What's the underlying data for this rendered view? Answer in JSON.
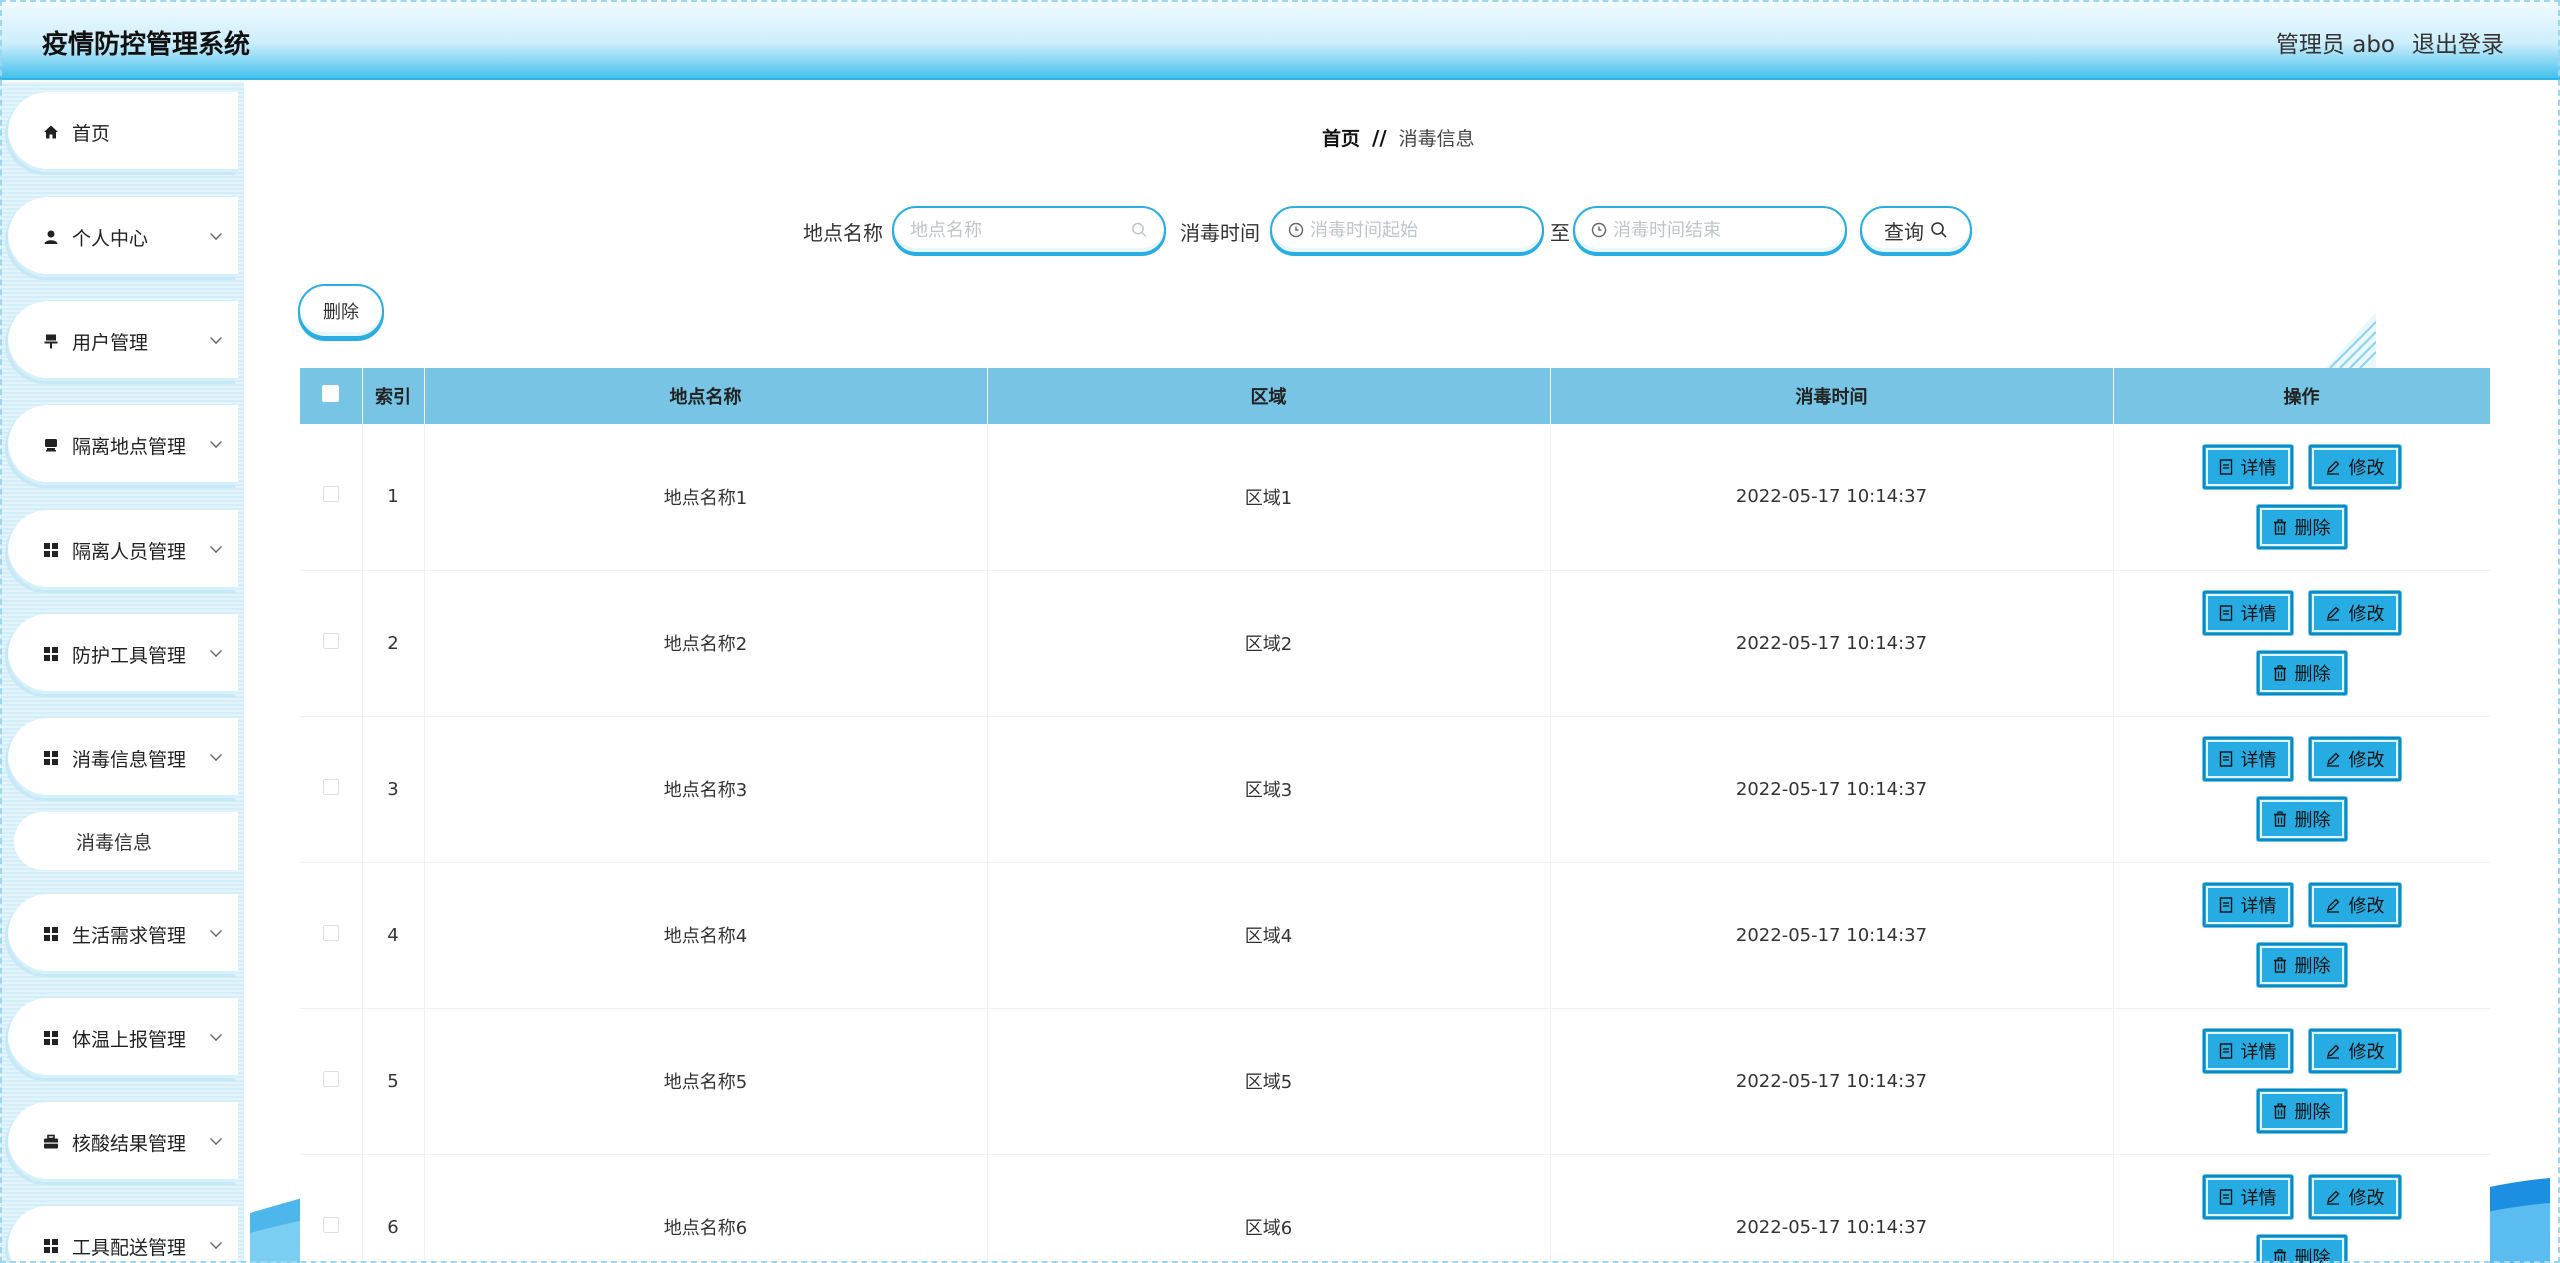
{
  "header": {
    "title": "疫情防控管理系统",
    "user": "管理员 abo",
    "logout": "退出登录"
  },
  "sidebar": {
    "items": [
      {
        "label": "首页",
        "icon": "home-icon"
      },
      {
        "label": "个人中心",
        "icon": "user-icon"
      },
      {
        "label": "用户管理",
        "icon": "users-icon"
      },
      {
        "label": "隔离地点管理",
        "icon": "location-icon"
      },
      {
        "label": "隔离人员管理",
        "icon": "grid-icon"
      },
      {
        "label": "防护工具管理",
        "icon": "grid-icon"
      },
      {
        "label": "消毒信息管理",
        "icon": "grid-icon"
      },
      {
        "label": "生活需求管理",
        "icon": "grid-icon"
      },
      {
        "label": "体温上报管理",
        "icon": "grid-icon"
      },
      {
        "label": "核酸结果管理",
        "icon": "briefcase-icon"
      },
      {
        "label": "工具配送管理",
        "icon": "grid-icon"
      }
    ],
    "sub_item": "消毒信息"
  },
  "breadcrumb": {
    "home": "首页",
    "separator": "//",
    "current": "消毒信息"
  },
  "filters": {
    "place_label": "地点名称",
    "place_placeholder": "地点名称",
    "time_label": "消毒时间",
    "start_placeholder": "消毒时间起始",
    "to_label": "至",
    "end_placeholder": "消毒时间结束",
    "search_label": "查询"
  },
  "toolbar": {
    "delete_label": "删除"
  },
  "table": {
    "columns": [
      "索引",
      "地点名称",
      "区域",
      "消毒时间",
      "操作"
    ],
    "rows": [
      {
        "index": "1",
        "place": "地点名称1",
        "area": "区域1",
        "time": "2022-05-17 10:14:37"
      },
      {
        "index": "2",
        "place": "地点名称2",
        "area": "区域2",
        "time": "2022-05-17 10:14:37"
      },
      {
        "index": "3",
        "place": "地点名称3",
        "area": "区域3",
        "time": "2022-05-17 10:14:37"
      },
      {
        "index": "4",
        "place": "地点名称4",
        "area": "区域4",
        "time": "2022-05-17 10:14:37"
      },
      {
        "index": "5",
        "place": "地点名称5",
        "area": "区域5",
        "time": "2022-05-17 10:14:37"
      },
      {
        "index": "6",
        "place": "地点名称6",
        "area": "区域6",
        "time": "2022-05-17 10:14:37"
      }
    ],
    "actions": {
      "detail": "详情",
      "edit": "修改",
      "delete": "删除"
    }
  },
  "colors": {
    "accent": "#26abe2",
    "header_row": "#77c4e4",
    "header_gradient_end": "#45c1ee"
  }
}
